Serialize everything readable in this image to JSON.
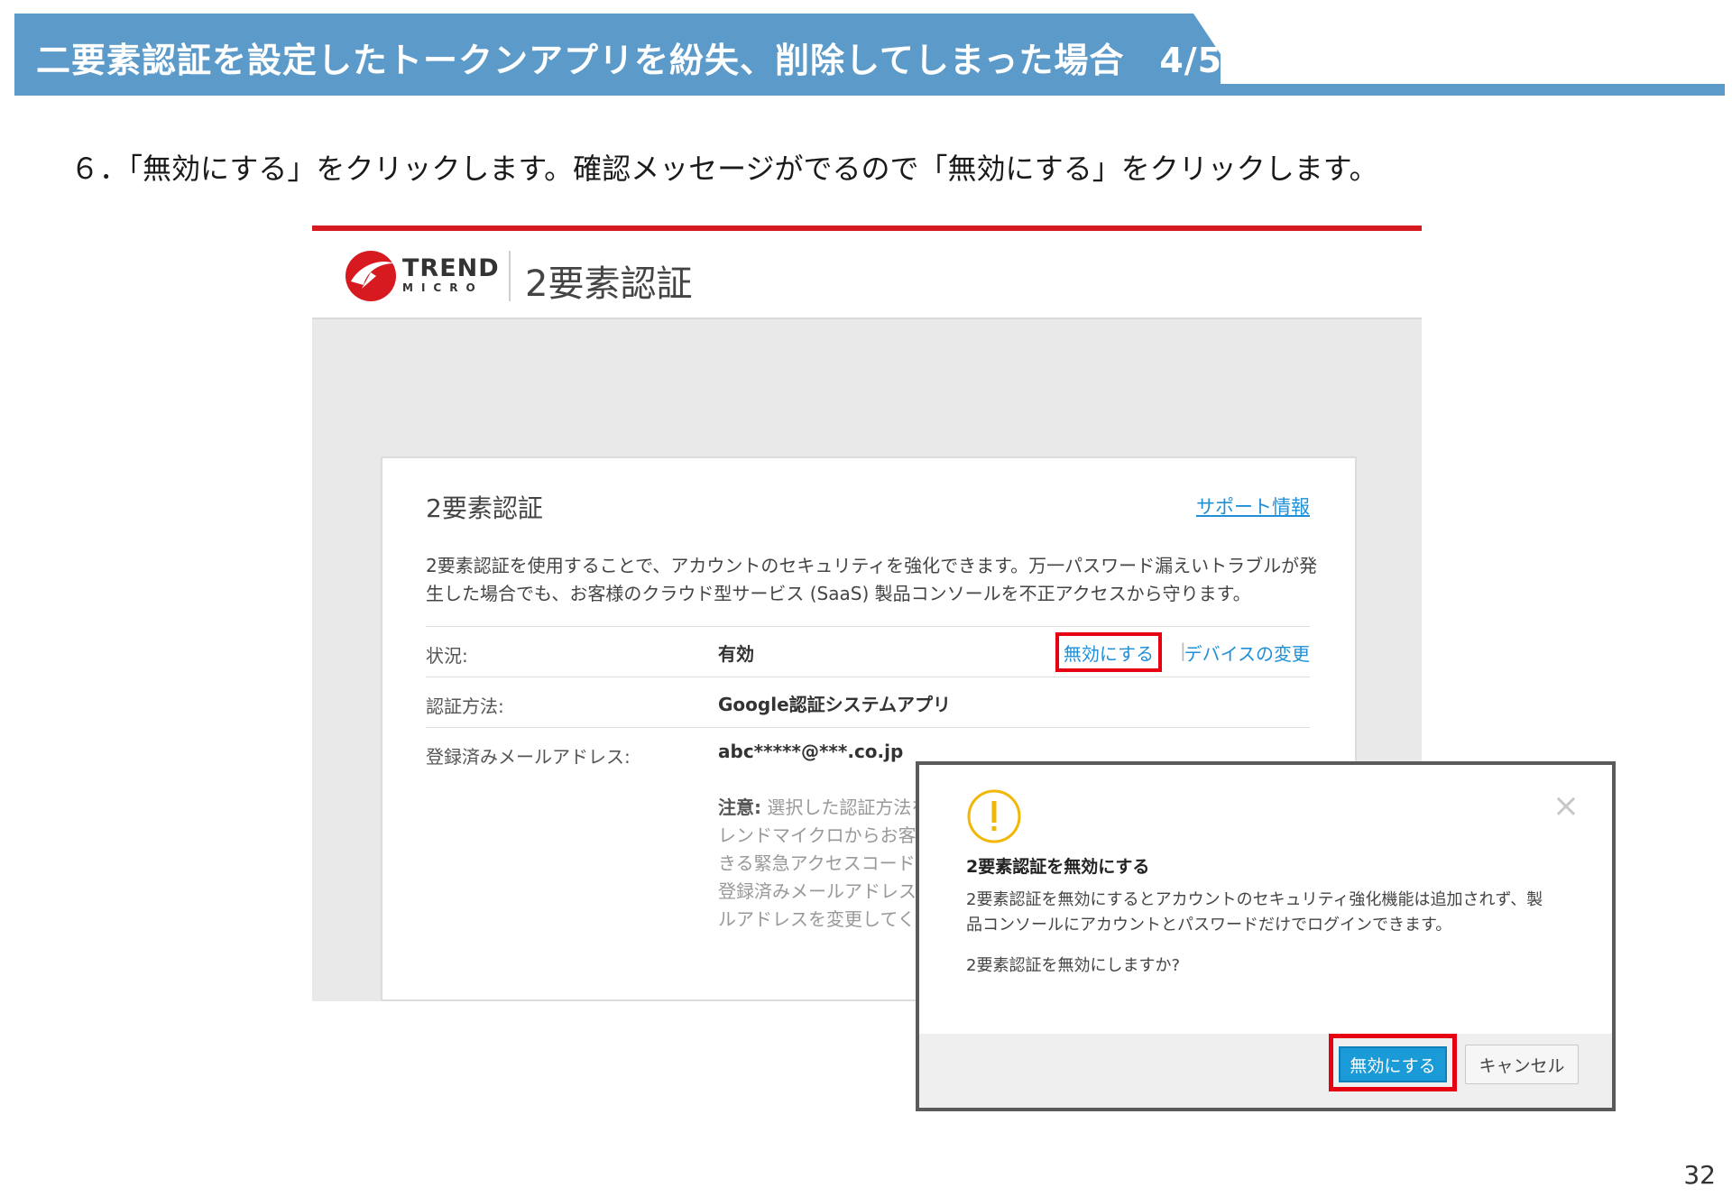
{
  "slide": {
    "title": "二要素認証を設定したトークンアプリを紛失、削除してしまった場合　4/5",
    "instruction": "６．「無効にする」をクリックします。確認メッセージがでるので「無効にする」をクリックします。",
    "page_number": "32",
    "accent_color": "#5b9ac9"
  },
  "app": {
    "logo_trend": "TREND",
    "logo_micro": "MICRO",
    "header_title": "2要素認証",
    "brand_color": "#d71920"
  },
  "card": {
    "title": "2要素認証",
    "support_link": "サポート情報",
    "description": "2要素認証を使用することで、アカウントのセキュリティを強化できます。万一パスワード漏えいトラブルが発生した場合でも、お客様のクラウド型サービス (SaaS) 製品コンソールを不正アクセスから守ります。",
    "rows": [
      {
        "label": "状況:",
        "value": "有効"
      },
      {
        "label": "認証方法:",
        "value": "Google認証システムアプリ"
      },
      {
        "label": "登録済みメールアドレス:",
        "value": "abc*****@***.co.jp"
      }
    ],
    "disable_link": "無効にする",
    "device_link": "デバイスの変更",
    "note_label": "注意:",
    "note_lines": [
      "選択した認証方法を",
      "レンドマイクロからお客",
      "きる緊急アクセスコード",
      "登録済みメールアドレス",
      "ルアドレスを変更してく"
    ]
  },
  "dialog": {
    "title": "2要素認証を無効にする",
    "body": "2要素認証を無効にするとアカウントのセキュリティ強化機能は追加されず、製品コンソールにアカウントとパスワードだけでログインできます。",
    "question": "2要素認証を無効にしますか?",
    "confirm_button": "無効にする",
    "cancel_button": "キャンセル",
    "close_icon": "close-icon",
    "warning_icon": "warning-icon"
  }
}
